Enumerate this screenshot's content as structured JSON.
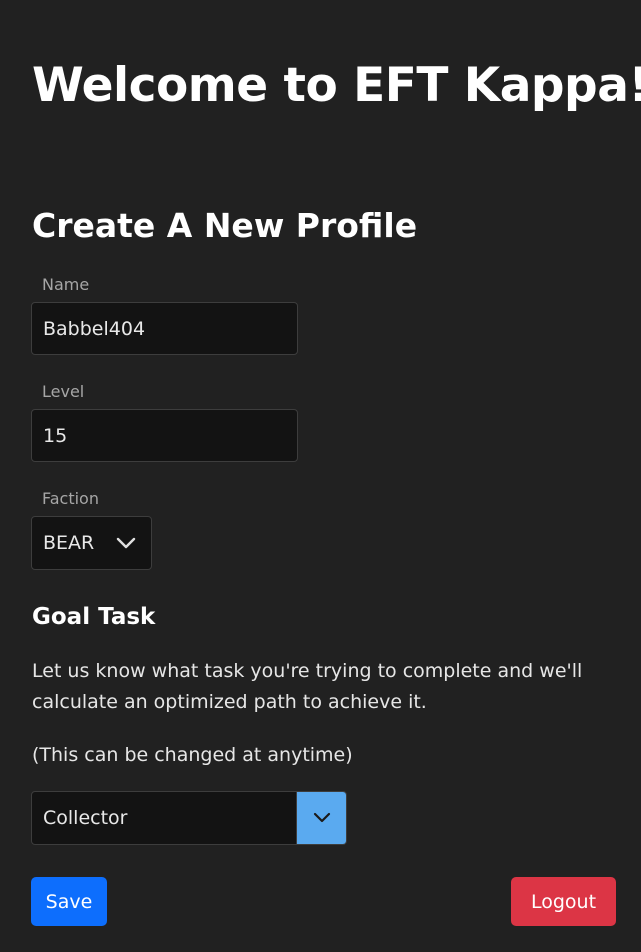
{
  "header": {
    "title": "Welcome to EFT Kappa!"
  },
  "profile_form": {
    "title": "Create A New Profile",
    "name_label": "Name",
    "name_value": "Babbel404",
    "level_label": "Level",
    "level_value": "15",
    "faction_label": "Faction",
    "faction_value": "BEAR"
  },
  "goal": {
    "title": "Goal Task",
    "description": "Let us know what task you're trying to complete and we'll calculate an optimized path to achieve it.",
    "note": "(This can be changed at anytime)",
    "selected_task": "Collector"
  },
  "actions": {
    "save_label": "Save",
    "logout_label": "Logout"
  },
  "icons": {
    "faction_dropdown": "chevron-down-icon",
    "task_dropdown": "chevron-down-icon"
  },
  "colors": {
    "background": "#212121",
    "save_button": "#0d6efd",
    "logout_button": "#dc3545",
    "dropdown_toggle": "#5aaaf0"
  }
}
